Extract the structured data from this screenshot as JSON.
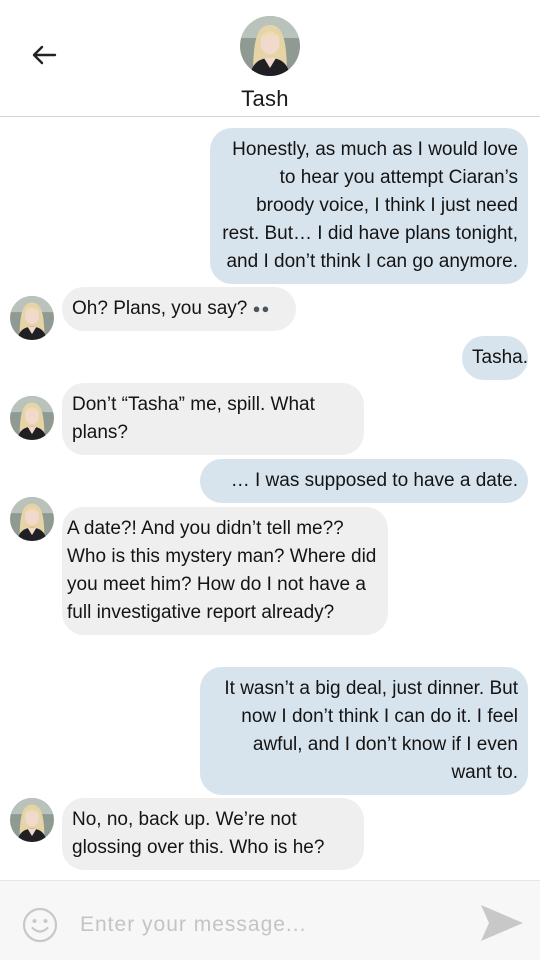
{
  "header": {
    "contact_name": "Tash"
  },
  "messages": [
    {
      "from": "me",
      "text": "Honestly, as much as I would love to hear you attempt Ciaran’s broody voice, I think I just need rest. But… I did have plans tonight, and I don’t think I can go anymore."
    },
    {
      "from": "contact",
      "text": "Oh? Plans, you say?",
      "emoji": "eyes-emoji"
    },
    {
      "from": "me",
      "text": "Tasha."
    },
    {
      "from": "contact",
      "text": "Don’t “Tasha” me, spill. What plans?"
    },
    {
      "from": "me",
      "text": "… I was supposed to have a date."
    },
    {
      "from": "contact",
      "text": "A date?! And you didn’t tell me?? Who is this mystery man? Where did you meet him? How do I not have a full investigative report already?"
    },
    {
      "from": "me",
      "text": "It wasn’t a big deal, just dinner. But now I don’t think I can do it. I feel awful, and I don’t know if I even want to."
    },
    {
      "from": "contact",
      "text": "No, no, back up. We’re not glossing over this. Who is he?"
    }
  ],
  "composer": {
    "placeholder": "Enter your message...",
    "value": ""
  },
  "icons": {
    "back": "arrow-left-icon",
    "emoji": "smiley-icon",
    "send": "send-icon"
  },
  "colors": {
    "sent_bubble": "#d7e4ee",
    "received_bubble": "#efefef",
    "header_divider": "#d6d6d6",
    "composer_bg": "#f7f7f7",
    "icon_gray": "#c8c8c8"
  }
}
